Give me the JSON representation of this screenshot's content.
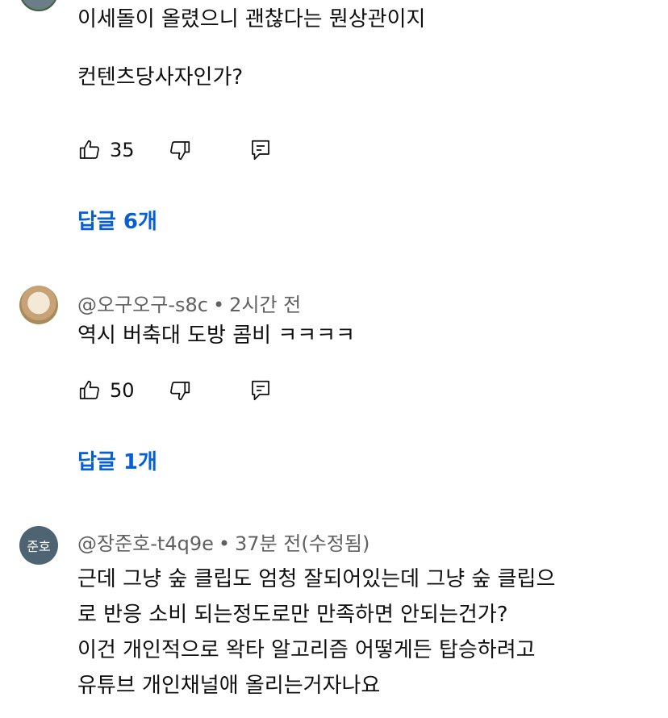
{
  "comments": [
    {
      "text": "이세돌이 올렸으니 괜찮다는 뭔상관이지\n\n컨텐츠당사자인가?",
      "likes": "35",
      "replies_label": "답글 6개"
    },
    {
      "author": "@오구오구-s8c",
      "separator": "•",
      "time": "2시간 전",
      "text": "역시 버축대 도방 콤비 ㅋㅋㅋㅋ",
      "likes": "50",
      "replies_label": "답글 1개"
    },
    {
      "avatar_text": "준호",
      "author": "@장준호-t4q9e",
      "separator": "•",
      "time": "37분 전(수정됨)",
      "text": "근데 그냥 숲 클립도 엄청 잘되어있는데 그냥 숲 클립으\n로 반응 소비 되는정도로만 만족하면 안되는건가?\n이건 개인적으로 왁타 알고리즘 어떻게든 탑승하려고\n유튜브 개인채널애 올리는거자나요"
    }
  ],
  "icons": {
    "like": "thumbs-up-icon",
    "dislike": "thumbs-down-icon",
    "reply": "reply-icon"
  }
}
